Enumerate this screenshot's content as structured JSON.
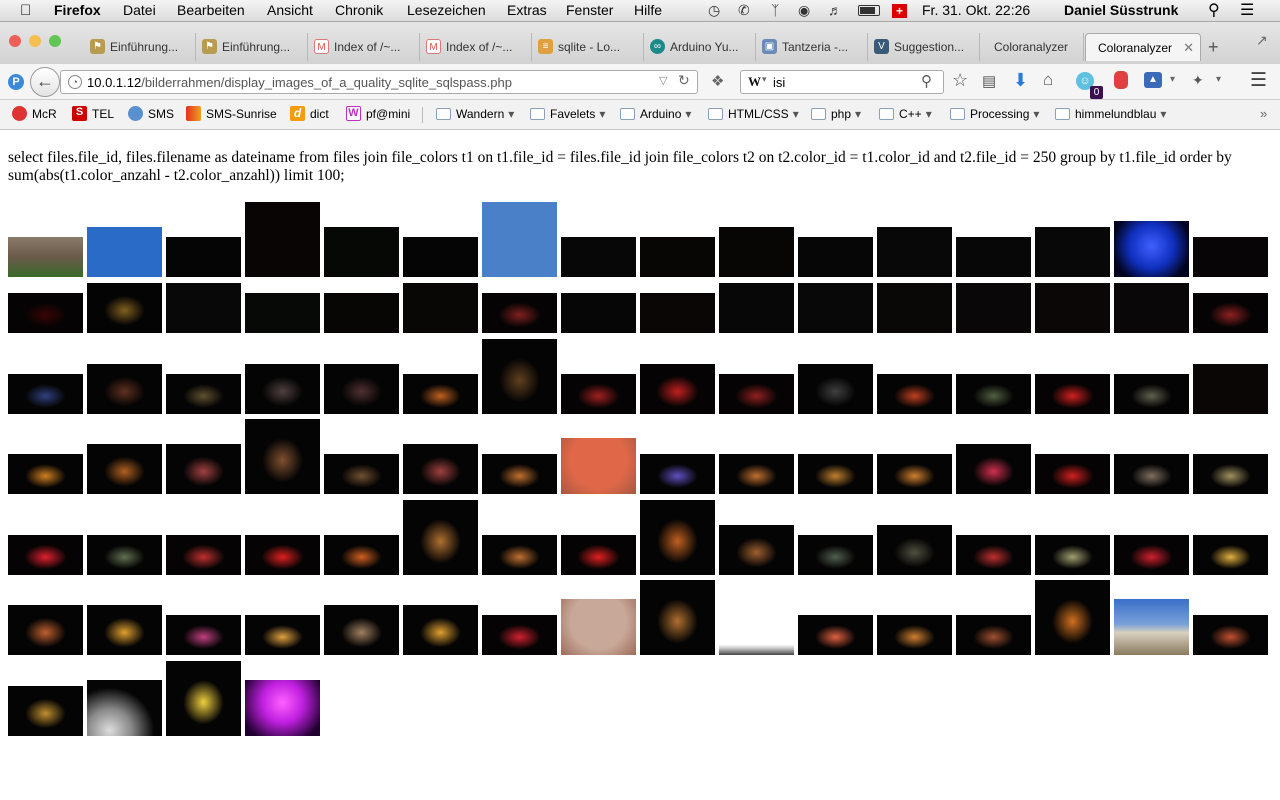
{
  "menubar": {
    "apple_icon": "apple-logo-icon",
    "app_name": "Firefox",
    "items": [
      "Datei",
      "Bearbeiten",
      "Ansicht",
      "Chronik",
      "Lesezeichen",
      "Extras",
      "Fenster",
      "Hilfe"
    ],
    "clock": "Fr. 31. Okt.  22:26",
    "user": "Daniel Süsstrunk"
  },
  "tabs": [
    {
      "label": "Einführung...",
      "icon": "bookmark-icon"
    },
    {
      "label": "Einführung...",
      "icon": "bookmark-icon"
    },
    {
      "label": "Index of /~...",
      "icon": "page-icon"
    },
    {
      "label": "Index of /~...",
      "icon": "page-icon"
    },
    {
      "label": "sqlite - Lo...",
      "icon": "stackoverflow-icon"
    },
    {
      "label": "Arduino Yu...",
      "icon": "arduino-icon"
    },
    {
      "label": "Tantzeria -...",
      "icon": "calendar-icon"
    },
    {
      "label": "Suggestion...",
      "icon": "v-icon"
    },
    {
      "label": "Coloranalyzer",
      "icon": ""
    },
    {
      "label": "Coloranalyzer",
      "icon": "",
      "active": true
    }
  ],
  "navbar": {
    "url_host": "10.0.1.12",
    "url_path": "/bilderrahmen/display_images_of_a_quality_sqlite_sqlspass.php",
    "search_engine": "W",
    "search_value": "isi",
    "badge": "0"
  },
  "bookmarks": [
    {
      "label": "McR",
      "color": "#d33"
    },
    {
      "label": "TEL",
      "color": "#c00"
    },
    {
      "label": "SMS",
      "color": "#5a8fd0"
    },
    {
      "label": "SMS-Sunrise",
      "color": "#e05a20"
    },
    {
      "label": "dict",
      "color": "#f39c12"
    },
    {
      "label": "pf@mini",
      "color": "#c030c0"
    },
    {
      "label": "Wandern",
      "folder": true
    },
    {
      "label": "Favelets",
      "folder": true
    },
    {
      "label": "Arduino",
      "folder": true
    },
    {
      "label": "HTML/CSS",
      "folder": true
    },
    {
      "label": "php",
      "folder": true
    },
    {
      "label": "C++",
      "folder": true
    },
    {
      "label": "Processing",
      "folder": true
    },
    {
      "label": "himmelundblau",
      "folder": true
    }
  ],
  "page": {
    "query": "select files.file_id, files.filename as dateiname from files join file_colors t1 on t1.file_id = files.file_id join file_colors t2 on t2.color_id = t1.color_id and t2.file_id = 250 group by t1.file_id order by sum(abs(t1.color_anzahl - t2.color_anzahl)) limit 100;"
  },
  "thumbnails": [
    [
      {
        "type": "photo-room",
        "color": "#6a5a4a",
        "ratio": 0.53
      },
      {
        "type": "sky",
        "color": "#2a6bc8",
        "ratio": 0.66
      },
      {
        "type": "dark",
        "color": "#050505",
        "ratio": 0.53
      },
      {
        "type": "dark",
        "color": "#0a0505",
        "ratio": 1.0
      },
      {
        "type": "dark",
        "color": "#060806",
        "ratio": 0.66
      },
      {
        "type": "dark",
        "color": "#050505",
        "ratio": 0.53
      },
      {
        "type": "sky",
        "color": "#4a80c8",
        "ratio": 1.0
      },
      {
        "type": "dark",
        "color": "#070707",
        "ratio": 0.53
      },
      {
        "type": "dark",
        "color": "#080505",
        "ratio": 0.53
      },
      {
        "type": "dark",
        "color": "#080505",
        "ratio": 0.66
      },
      {
        "type": "dark",
        "color": "#060606",
        "ratio": 0.53
      },
      {
        "type": "dark",
        "color": "#080808",
        "ratio": 0.66
      },
      {
        "type": "dark",
        "color": "#070707",
        "ratio": 0.53
      },
      {
        "type": "dark",
        "color": "#080808",
        "ratio": 0.66
      },
      {
        "type": "blue-lights",
        "color": "#1030c0",
        "ratio": 0.75
      },
      {
        "type": "dark",
        "color": "#070505",
        "ratio": 0.53
      }
    ],
    [
      {
        "type": "red-glow",
        "color": "#3a0505",
        "ratio": 0.53
      },
      {
        "type": "firework",
        "color": "#806020",
        "ratio": 0.66
      },
      {
        "type": "dark",
        "color": "#080808",
        "ratio": 0.66
      },
      {
        "type": "dark",
        "color": "#070907",
        "ratio": 0.53
      },
      {
        "type": "dark",
        "color": "#080505",
        "ratio": 0.53
      },
      {
        "type": "dark",
        "color": "#090606",
        "ratio": 0.66
      },
      {
        "type": "red-glow",
        "color": "#802020",
        "ratio": 0.53
      },
      {
        "type": "dark",
        "color": "#060606",
        "ratio": 0.53
      },
      {
        "type": "dark",
        "color": "#0a0606",
        "ratio": 0.53
      },
      {
        "type": "dark",
        "color": "#070707",
        "ratio": 0.66
      },
      {
        "type": "dark",
        "color": "#080808",
        "ratio": 0.66
      },
      {
        "type": "dark",
        "color": "#0a0707",
        "ratio": 0.66
      },
      {
        "type": "dark",
        "color": "#090707",
        "ratio": 0.66
      },
      {
        "type": "dark",
        "color": "#0b0707",
        "ratio": 0.66
      },
      {
        "type": "dark",
        "color": "#090707",
        "ratio": 0.66
      },
      {
        "type": "red-glow",
        "color": "#902020",
        "ratio": 0.53
      }
    ],
    [
      {
        "type": "firework",
        "color": "#304080",
        "ratio": 0.53
      },
      {
        "type": "firework",
        "color": "#603020",
        "ratio": 0.66
      },
      {
        "type": "firework",
        "color": "#605030",
        "ratio": 0.53
      },
      {
        "type": "firework",
        "color": "#504040",
        "ratio": 0.66
      },
      {
        "type": "firework",
        "color": "#503030",
        "ratio": 0.66
      },
      {
        "type": "firework",
        "color": "#c06020",
        "ratio": 0.53
      },
      {
        "type": "firework",
        "color": "#604020",
        "ratio": 1.0
      },
      {
        "type": "red-glow",
        "color": "#a02020",
        "ratio": 0.53
      },
      {
        "type": "red-glow",
        "color": "#c02020",
        "ratio": 0.66
      },
      {
        "type": "red-glow",
        "color": "#902020",
        "ratio": 0.53
      },
      {
        "type": "firework",
        "color": "#404040",
        "ratio": 0.66
      },
      {
        "type": "firework",
        "color": "#c04020",
        "ratio": 0.53
      },
      {
        "type": "firework",
        "color": "#506040",
        "ratio": 0.53
      },
      {
        "type": "red-glow",
        "color": "#d02020",
        "ratio": 0.53
      },
      {
        "type": "firework",
        "color": "#606050",
        "ratio": 0.53
      },
      {
        "type": "dark",
        "color": "#0a0606",
        "ratio": 0.66
      }
    ],
    [
      {
        "type": "firework",
        "color": "#d08020",
        "ratio": 0.53
      },
      {
        "type": "firework",
        "color": "#b06020",
        "ratio": 0.66
      },
      {
        "type": "firework",
        "color": "#a04040",
        "ratio": 0.66
      },
      {
        "type": "firework",
        "color": "#805030",
        "ratio": 1.0
      },
      {
        "type": "firework",
        "color": "#705030",
        "ratio": 0.53
      },
      {
        "type": "firework",
        "color": "#a04040",
        "ratio": 0.66
      },
      {
        "type": "firework",
        "color": "#c07030",
        "ratio": 0.53
      },
      {
        "type": "peach",
        "color": "#e06848",
        "ratio": 0.75
      },
      {
        "type": "firework",
        "color": "#6050c0",
        "ratio": 0.53
      },
      {
        "type": "firework",
        "color": "#c07030",
        "ratio": 0.53
      },
      {
        "type": "firework",
        "color": "#c08030",
        "ratio": 0.53
      },
      {
        "type": "firework",
        "color": "#d08030",
        "ratio": 0.53
      },
      {
        "type": "firework",
        "color": "#d03050",
        "ratio": 0.66
      },
      {
        "type": "red-glow",
        "color": "#d02020",
        "ratio": 0.53
      },
      {
        "type": "firework",
        "color": "#807060",
        "ratio": 0.53
      },
      {
        "type": "firework",
        "color": "#a09060",
        "ratio": 0.53
      }
    ],
    [
      {
        "type": "red-glow",
        "color": "#e02030",
        "ratio": 0.53
      },
      {
        "type": "firework",
        "color": "#607050",
        "ratio": 0.53
      },
      {
        "type": "red-glow",
        "color": "#c03030",
        "ratio": 0.53
      },
      {
        "type": "red-glow",
        "color": "#e02020",
        "ratio": 0.53
      },
      {
        "type": "firework",
        "color": "#d06020",
        "ratio": 0.53
      },
      {
        "type": "firework",
        "color": "#b07030",
        "ratio": 1.0
      },
      {
        "type": "firework",
        "color": "#c07030",
        "ratio": 0.53
      },
      {
        "type": "red-glow",
        "color": "#e02020",
        "ratio": 0.53
      },
      {
        "type": "firework",
        "color": "#c06020",
        "ratio": 1.0
      },
      {
        "type": "firework",
        "color": "#a06030",
        "ratio": 0.66
      },
      {
        "type": "firework",
        "color": "#506050",
        "ratio": 0.53
      },
      {
        "type": "firework",
        "color": "#505040",
        "ratio": 0.66
      },
      {
        "type": "firework",
        "color": "#c03030",
        "ratio": 0.53
      },
      {
        "type": "firework",
        "color": "#a0a070",
        "ratio": 0.53
      },
      {
        "type": "red-glow",
        "color": "#d02030",
        "ratio": 0.53
      },
      {
        "type": "firework",
        "color": "#e0b040",
        "ratio": 0.53
      }
    ],
    [
      {
        "type": "firework",
        "color": "#c06030",
        "ratio": 0.66
      },
      {
        "type": "firework",
        "color": "#e0a030",
        "ratio": 0.66
      },
      {
        "type": "firework",
        "color": "#c04080",
        "ratio": 0.53
      },
      {
        "type": "firework",
        "color": "#e0a040",
        "ratio": 0.53
      },
      {
        "type": "firework",
        "color": "#a08060",
        "ratio": 0.66
      },
      {
        "type": "firework",
        "color": "#e0a030",
        "ratio": 0.66
      },
      {
        "type": "red-glow",
        "color": "#d02030",
        "ratio": 0.53
      },
      {
        "type": "peach",
        "color": "#c8a898",
        "ratio": 0.75
      },
      {
        "type": "firework",
        "color": "#b07030",
        "ratio": 1.0
      },
      {
        "type": "snow",
        "color": "#bbbbbb",
        "ratio": 0.2
      },
      {
        "type": "firework",
        "color": "#e06040",
        "ratio": 0.53
      },
      {
        "type": "firework",
        "color": "#d08030",
        "ratio": 0.53
      },
      {
        "type": "firework",
        "color": "#a05030",
        "ratio": 0.53
      },
      {
        "type": "firework",
        "color": "#d07020",
        "ratio": 1.0
      },
      {
        "type": "mountain",
        "color": "#3a70c8",
        "ratio": 0.75
      },
      {
        "type": "firework",
        "color": "#c05030",
        "ratio": 0.53
      }
    ],
    [
      {
        "type": "firework",
        "color": "#c09030",
        "ratio": 0.66
      },
      {
        "type": "snow-night",
        "color": "#888888",
        "ratio": 0.75
      },
      {
        "type": "firework",
        "color": "#f0d040",
        "ratio": 1.0
      },
      {
        "type": "purple-lights",
        "color": "#c020e0",
        "ratio": 0.75
      }
    ]
  ]
}
